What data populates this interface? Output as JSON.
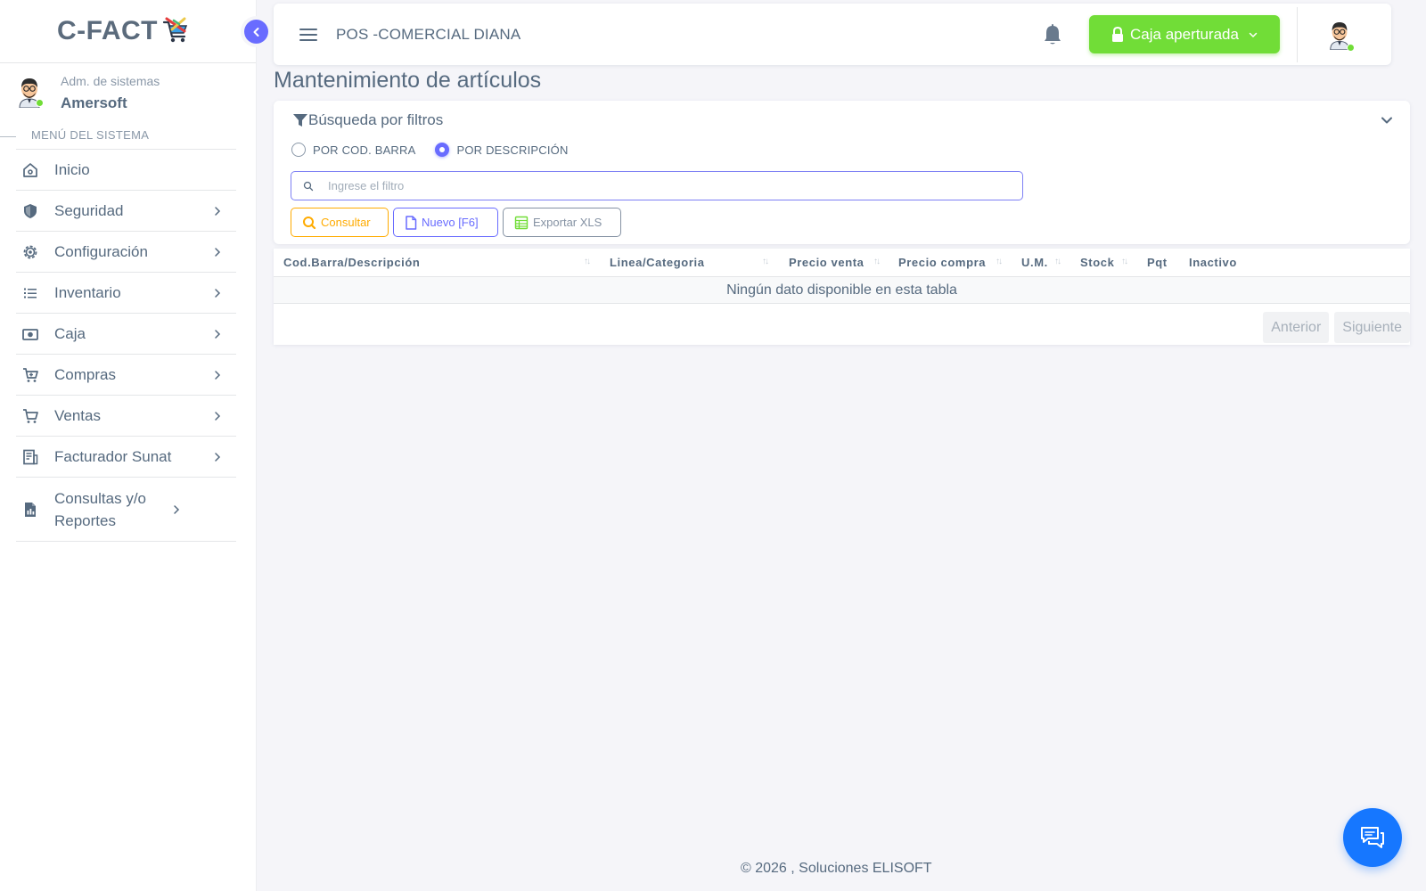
{
  "app": {
    "brand": "C-FACT",
    "colors": {
      "primary": "#696cff",
      "success": "#71dd37",
      "warning": "#ffab00",
      "info": "#1677ff",
      "text": "#566a7f"
    }
  },
  "sidebar": {
    "user_role": "Adm. de sistemas",
    "user_name": "Amersoft",
    "menu_header": "MENÚ DEL SISTEMA",
    "items": [
      {
        "label": "Inicio",
        "icon": "home-icon"
      },
      {
        "label": "Seguridad",
        "icon": "shield-icon"
      },
      {
        "label": "Configuración",
        "icon": "gear-icon"
      },
      {
        "label": "Inventario",
        "icon": "list-icon"
      },
      {
        "label": "Caja",
        "icon": "cash-icon"
      },
      {
        "label": "Compras",
        "icon": "cart-plus-icon"
      },
      {
        "label": "Ventas",
        "icon": "cart-icon"
      },
      {
        "label": "Facturador Sunat",
        "icon": "invoice-icon"
      },
      {
        "label": "Consultas y/o Reportes",
        "icon": "report-icon"
      }
    ]
  },
  "navbar": {
    "title": "POS -COMERCIAL DIANA",
    "caja_label": "Caja aperturada"
  },
  "page": {
    "title": "Mantenimiento de artículos"
  },
  "filters": {
    "header": "Búsqueda por filtros",
    "radio_barcode": "POR COD. BARRA",
    "radio_description": "POR DESCRIPCIÓN",
    "selected": "description",
    "search_placeholder": "Ingrese el filtro",
    "search_value": "",
    "btn_consultar": "Consultar",
    "btn_nuevo": "Nuevo [F6]",
    "btn_export": "Exportar XLS"
  },
  "table": {
    "columns": [
      "Cod.Barra/Descripción",
      "Linea/Categoria",
      "Precio venta",
      "Precio compra",
      "U.M.",
      "Stock",
      "Pqt",
      "Inactivo"
    ],
    "empty_message": "Ningún dato disponible en esta tabla",
    "prev_label": "Anterior",
    "next_label": "Siguiente"
  },
  "footer": {
    "text": "© 2026 , Soluciones ELISOFT"
  }
}
